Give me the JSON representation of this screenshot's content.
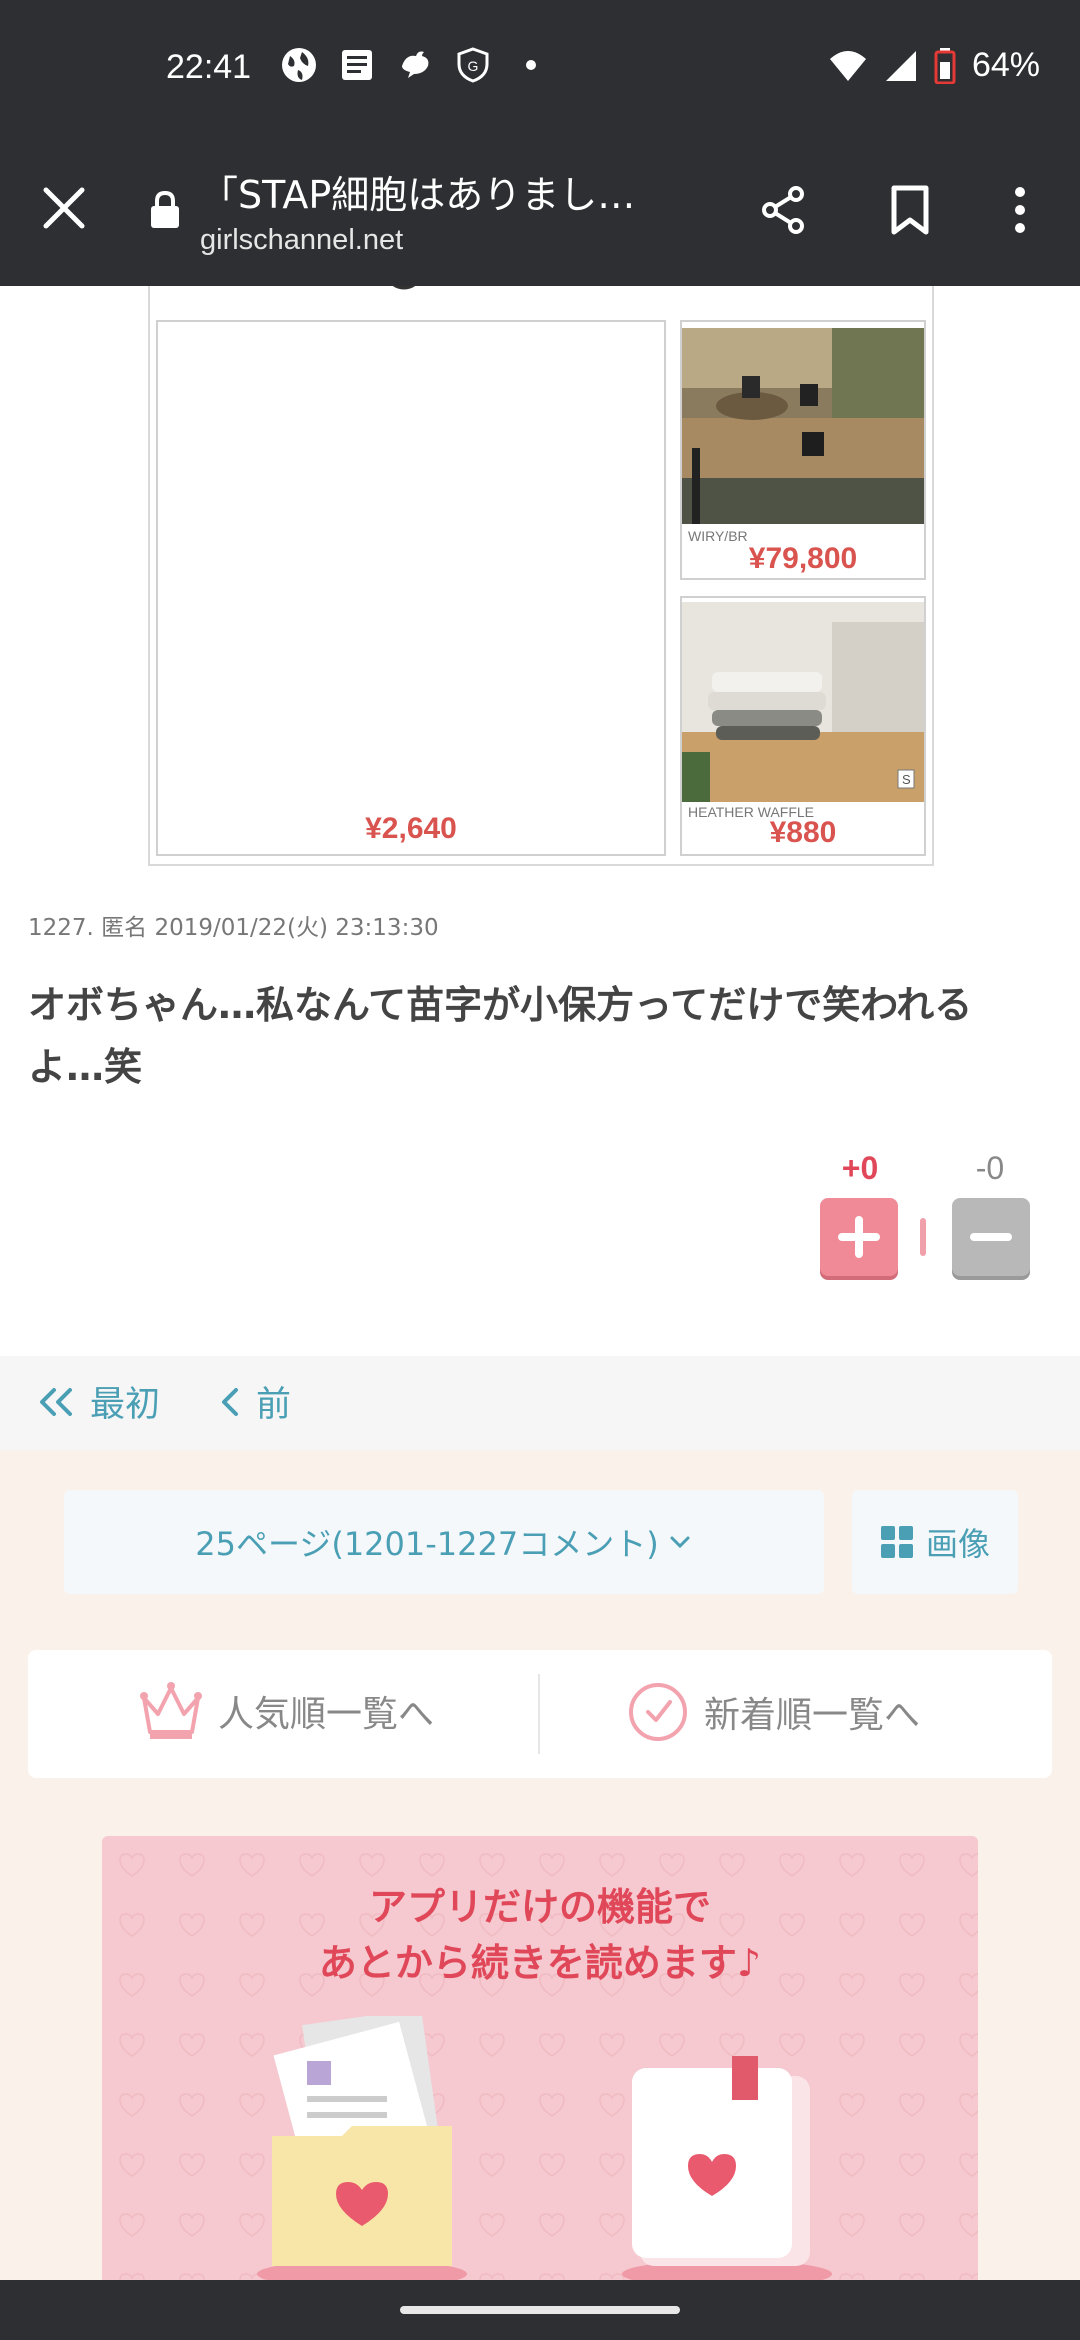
{
  "status_bar": {
    "time": "22:41",
    "battery_percent": "64%",
    "notification_icons": [
      "globe-icon",
      "news-icon",
      "bird-icon",
      "shield-icon",
      "dot-icon"
    ],
    "signal_icons": [
      "wifi-icon",
      "cellular-icon",
      "battery-icon"
    ]
  },
  "toolbar": {
    "title": "「STAP細胞はありまし…",
    "url": "girlschannel.net"
  },
  "ad": {
    "main_price": "¥2,640",
    "item1_label": "WIRY/BR",
    "item1_price": "¥79,800",
    "item2_label": "HEATHER WAFFLE",
    "item2_price": "¥880",
    "item2_badge": "S"
  },
  "comment": {
    "meta": "1227. 匿名 2019/01/22(火) 23:13:30",
    "text": "オボちゃん…私なんて苗字が小保方ってだけで笑われるよ…笑",
    "plus_count": "+0",
    "minus_count": "-0"
  },
  "pager": {
    "first_label": "最初",
    "prev_label": "前",
    "page_select": "25ページ(1201-1227コメント)",
    "image_label": "画像"
  },
  "sort": {
    "popular_label": "人気順一覧へ",
    "newest_label": "新着順一覧へ"
  },
  "promo": {
    "line1": "アプリだけの機能で",
    "line2": "あとから続きを読めます♪"
  },
  "colors": {
    "bar_dark": "#2d2f32",
    "link_teal": "#4a9fb5",
    "accent_pink": "#e0485a",
    "price_red": "#d9534f"
  }
}
